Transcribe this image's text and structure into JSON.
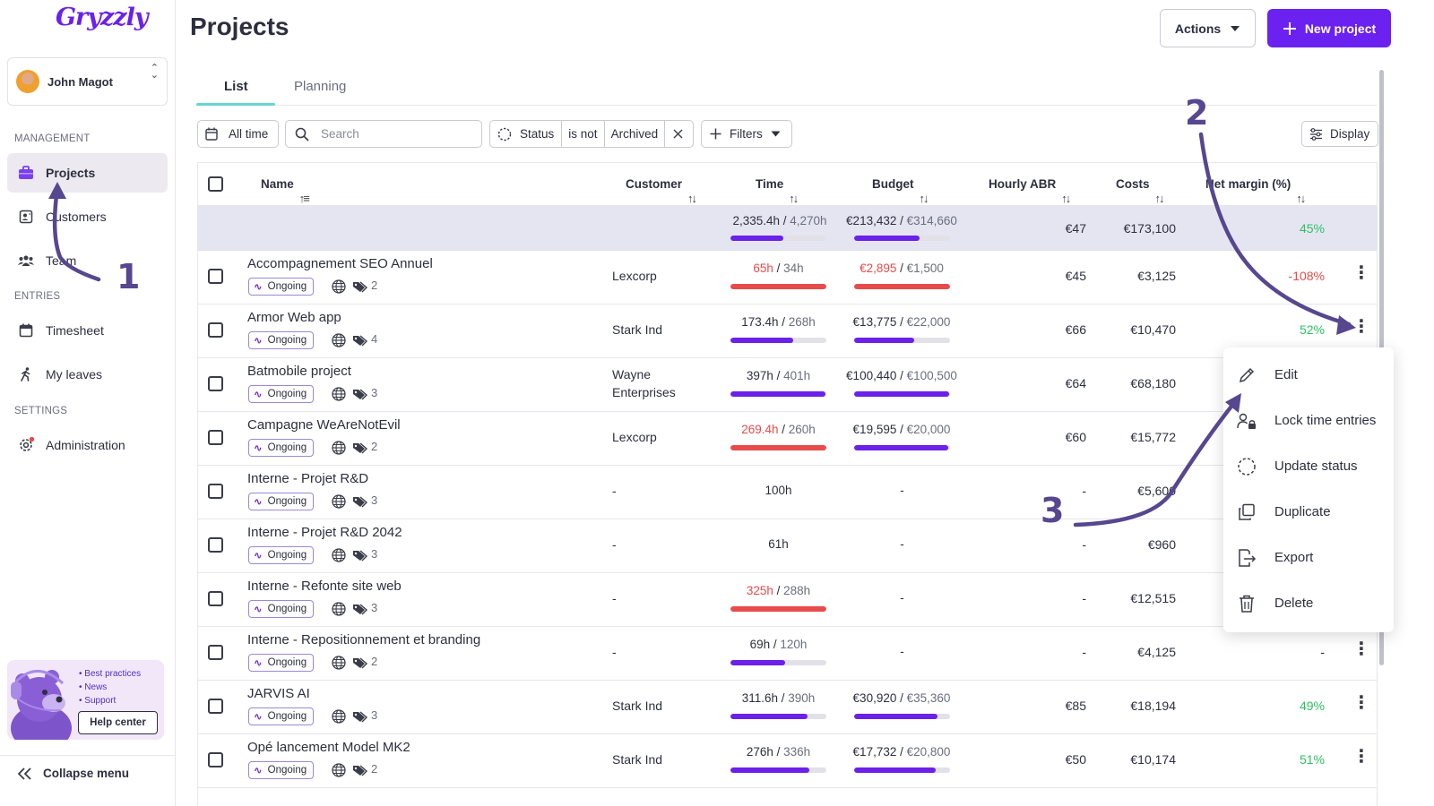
{
  "app": {
    "logo_text": "Gryzzly",
    "accent": "#6b21f0"
  },
  "sidebar": {
    "user_name": "John Magot",
    "sections": {
      "management": "MANAGEMENT",
      "entries": "ENTRIES",
      "settings": "SETTINGS"
    },
    "items": [
      {
        "label": "Projects",
        "icon": "briefcase-icon",
        "active": true
      },
      {
        "label": "Customers",
        "icon": "contact-card-icon"
      },
      {
        "label": "Team",
        "icon": "team-icon"
      },
      {
        "label": "Timesheet",
        "icon": "calendar-icon"
      },
      {
        "label": "My leaves",
        "icon": "walking-person-icon"
      },
      {
        "label": "Administration",
        "icon": "gear-icon"
      }
    ],
    "promo": {
      "bullets": [
        "Best practices",
        "News",
        "Support"
      ],
      "button": "Help center"
    },
    "collapse_label": "Collapse menu"
  },
  "header": {
    "title": "Projects",
    "actions_label": "Actions",
    "new_project_label": "New project"
  },
  "tabs": [
    "List",
    "Planning"
  ],
  "filters": {
    "period": "All time",
    "search_placeholder": "Search",
    "status_field": "Status",
    "status_operator": "is not",
    "status_value": "Archived",
    "filters_label": "Filters",
    "display_label": "Display"
  },
  "table": {
    "columns": {
      "name": "Name",
      "customer": "Customer",
      "time": "Time",
      "budget": "Budget",
      "hourly_abr": "Hourly ABR",
      "costs": "Costs",
      "net_margin": "Net margin (%)"
    },
    "totals": {
      "time_spent": "2,335.4h",
      "time_total": "4,270h",
      "time_pct": 0.55,
      "budget_spent": "€213,432",
      "budget_total": "€314,660",
      "budget_pct": 0.68,
      "hourly_abr": "€47",
      "costs": "€173,100",
      "net_margin": "45%"
    },
    "status_label": "Ongoing",
    "rows": [
      {
        "name": "Accompagnement SEO Annuel",
        "tags": "2",
        "customer": "Lexcorp",
        "customer2": "",
        "time_spent": "65h",
        "time_total": "34h",
        "time_pct": 1.0,
        "time_over": true,
        "budget_spent": "€2,895",
        "budget_total": "€1,500",
        "budget_pct": 1.0,
        "budget_over": true,
        "hourly_abr": "€45",
        "costs": "€3,125",
        "net_margin": "-108%",
        "margin_color": "red",
        "has_time": true,
        "has_budget": true
      },
      {
        "name": "Armor Web app",
        "tags": "4",
        "customer": "Stark Ind",
        "customer2": "",
        "time_spent": "173.4h",
        "time_total": "268h",
        "time_pct": 0.65,
        "time_over": false,
        "budget_spent": "€13,775",
        "budget_total": "€22,000",
        "budget_pct": 0.63,
        "budget_over": false,
        "hourly_abr": "€66",
        "costs": "€10,470",
        "net_margin": "52%",
        "margin_color": "green",
        "has_time": true,
        "has_budget": true
      },
      {
        "name": "Batmobile project",
        "tags": "3",
        "customer": "Wayne",
        "customer2": "Enterprises",
        "time_spent": "397h",
        "time_total": "401h",
        "time_pct": 0.99,
        "time_over": false,
        "budget_spent": "€100,440",
        "budget_total": "€100,500",
        "budget_pct": 0.99,
        "budget_over": false,
        "hourly_abr": "€64",
        "costs": "€68,180",
        "net_margin": "",
        "margin_color": "",
        "has_time": true,
        "has_budget": true
      },
      {
        "name": "Campagne WeAreNotEvil",
        "tags": "2",
        "customer": "Lexcorp",
        "customer2": "",
        "time_spent": "269.4h",
        "time_total": "260h",
        "time_pct": 1.0,
        "time_over": true,
        "budget_spent": "€19,595",
        "budget_total": "€20,000",
        "budget_pct": 0.98,
        "budget_over": false,
        "hourly_abr": "€60",
        "costs": "€15,772",
        "net_margin": "",
        "margin_color": "",
        "has_time": true,
        "has_budget": true
      },
      {
        "name": "Interne - Projet R&D",
        "tags": "3",
        "customer": "-",
        "customer2": "",
        "time_plain": "100h",
        "budget_plain": "-",
        "hourly_abr": "-",
        "costs": "€5,600",
        "net_margin": "",
        "margin_color": "",
        "has_time": false,
        "has_budget": false
      },
      {
        "name": "Interne - Projet R&D 2042",
        "tags": "3",
        "customer": "-",
        "customer2": "",
        "time_plain": "61h",
        "budget_plain": "-",
        "hourly_abr": "-",
        "costs": "€960",
        "net_margin": "",
        "margin_color": "",
        "has_time": false,
        "has_budget": false
      },
      {
        "name": "Interne - Refonte site web",
        "tags": "3",
        "customer": "-",
        "customer2": "",
        "time_spent": "325h",
        "time_total": "288h",
        "time_pct": 1.0,
        "time_over": true,
        "budget_plain": "-",
        "hourly_abr": "-",
        "costs": "€12,515",
        "net_margin": "",
        "margin_color": "",
        "has_time": true,
        "has_budget": false
      },
      {
        "name": "Interne - Repositionnement et branding",
        "tags": "2",
        "customer": "-",
        "customer2": "",
        "time_spent": "69h",
        "time_total": "120h",
        "time_pct": 0.57,
        "time_over": false,
        "budget_plain": "-",
        "hourly_abr": "-",
        "costs": "€4,125",
        "net_margin": "-",
        "margin_color": "",
        "has_time": true,
        "has_budget": false
      },
      {
        "name": "JARVIS AI",
        "tags": "3",
        "customer": "Stark Ind",
        "customer2": "",
        "time_spent": "311.6h",
        "time_total": "390h",
        "time_pct": 0.8,
        "time_over": false,
        "budget_spent": "€30,920",
        "budget_total": "€35,360",
        "budget_pct": 0.87,
        "budget_over": false,
        "hourly_abr": "€85",
        "costs": "€18,194",
        "net_margin": "49%",
        "margin_color": "green",
        "has_time": true,
        "has_budget": true
      },
      {
        "name": "Opé lancement Model MK2",
        "tags": "2",
        "customer": "Stark Ind",
        "customer2": "",
        "time_spent": "276h",
        "time_total": "336h",
        "time_pct": 0.82,
        "time_over": false,
        "budget_spent": "€17,732",
        "budget_total": "€20,800",
        "budget_pct": 0.85,
        "budget_over": false,
        "hourly_abr": "€50",
        "costs": "€10,174",
        "net_margin": "51%",
        "margin_color": "green",
        "has_time": true,
        "has_budget": true
      }
    ]
  },
  "context_menu": {
    "items": [
      {
        "label": "Edit",
        "icon": "pencil-icon"
      },
      {
        "label": "Lock time entries",
        "icon": "user-lock-icon"
      },
      {
        "label": "Update status",
        "icon": "dashed-circle-icon"
      },
      {
        "label": "Duplicate",
        "icon": "duplicate-icon"
      },
      {
        "label": "Export",
        "icon": "export-icon"
      },
      {
        "label": "Delete",
        "icon": "trash-icon"
      }
    ]
  },
  "annotations": [
    "1",
    "2",
    "3"
  ],
  "colors": {
    "accent": "#6b21f0",
    "bar_fill": "#6b21e8",
    "bar_over": "#e84b4b",
    "margin_positive": "#2fbf62",
    "margin_negative": "#e84b4b",
    "annotation": "#56478f"
  }
}
